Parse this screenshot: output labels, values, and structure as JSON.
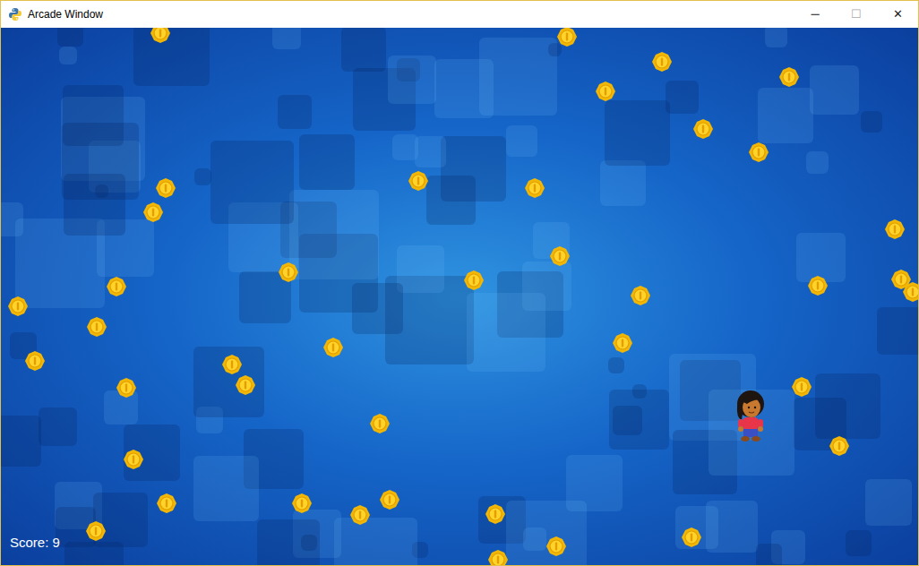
{
  "window": {
    "title": "Arcade Window",
    "controls": [
      "─",
      "☐",
      "✕"
    ]
  },
  "game": {
    "score": "Score: 9"
  }
}
